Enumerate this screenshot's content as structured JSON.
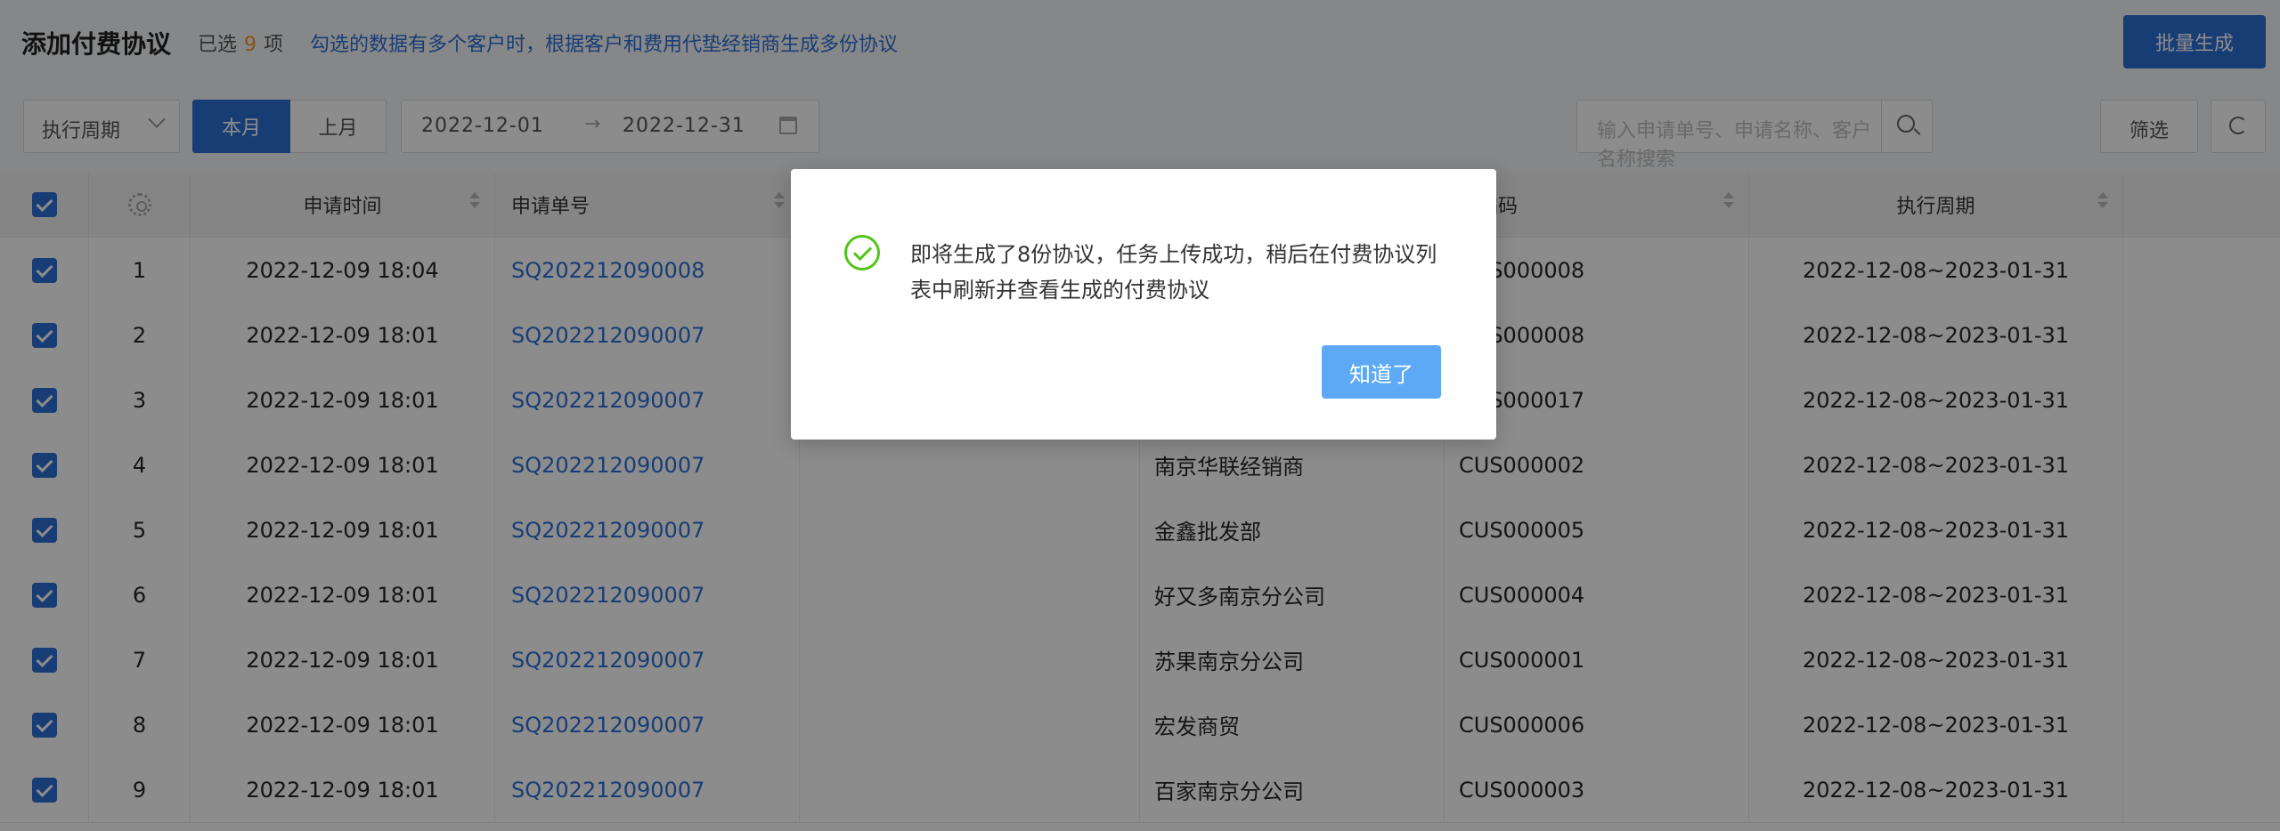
{
  "header": {
    "title": "添加付费协议",
    "selected_prefix": "已选",
    "selected_count": "9",
    "selected_suffix": "项",
    "notice": "勾选的数据有多个客户时，根据客户和费用代垫经销商生成多份协议",
    "batch_button": "批量生成"
  },
  "toolbar": {
    "period_select": "执行周期",
    "this_month": "本月",
    "last_month": "上月",
    "date_start": "2022-12-01",
    "date_arrow": "→",
    "date_end": "2022-12-31",
    "search_placeholder": "输入申请单号、申请名称、客户名称搜索",
    "filter_button": "筛选"
  },
  "table": {
    "columns": {
      "apply_time": "申请时间",
      "apply_no": "申请单号",
      "customer_code": "户编码",
      "exec_period": "执行周期"
    },
    "rows": [
      {
        "idx": "1",
        "time": "2022-12-09 18:04",
        "no": "SQ202212090008",
        "customer": "",
        "code": "CUS000008",
        "period": "2022-12-08~2023-01-31"
      },
      {
        "idx": "2",
        "time": "2022-12-09 18:01",
        "no": "SQ202212090007",
        "customer": "",
        "code": "CUS000008",
        "period": "2022-12-08~2023-01-31"
      },
      {
        "idx": "3",
        "time": "2022-12-09 18:01",
        "no": "SQ202212090007",
        "customer": "",
        "code": "CUS000017",
        "period": "2022-12-08~2023-01-31"
      },
      {
        "idx": "4",
        "time": "2022-12-09 18:01",
        "no": "SQ202212090007",
        "customer": "南京华联经销商",
        "code": "CUS000002",
        "period": "2022-12-08~2023-01-31"
      },
      {
        "idx": "5",
        "time": "2022-12-09 18:01",
        "no": "SQ202212090007",
        "customer": "金鑫批发部",
        "code": "CUS000005",
        "period": "2022-12-08~2023-01-31"
      },
      {
        "idx": "6",
        "time": "2022-12-09 18:01",
        "no": "SQ202212090007",
        "customer": "好又多南京分公司",
        "code": "CUS000004",
        "period": "2022-12-08~2023-01-31"
      },
      {
        "idx": "7",
        "time": "2022-12-09 18:01",
        "no": "SQ202212090007",
        "customer": "苏果南京分公司",
        "code": "CUS000001",
        "period": "2022-12-08~2023-01-31"
      },
      {
        "idx": "8",
        "time": "2022-12-09 18:01",
        "no": "SQ202212090007",
        "customer": "宏发商贸",
        "code": "CUS000006",
        "period": "2022-12-08~2023-01-31"
      },
      {
        "idx": "9",
        "time": "2022-12-09 18:01",
        "no": "SQ202212090007",
        "customer": "百家南京分公司",
        "code": "CUS000003",
        "period": "2022-12-08~2023-01-31"
      }
    ]
  },
  "modal": {
    "message": "即将生成了8份协议，任务上传成功，稍后在付费协议列表中刷新并查看生成的付费协议",
    "ack_button": "知道了"
  },
  "colors": {
    "primary": "#2d6fd6",
    "count_highlight": "#f59a23",
    "success": "#52c41a"
  }
}
